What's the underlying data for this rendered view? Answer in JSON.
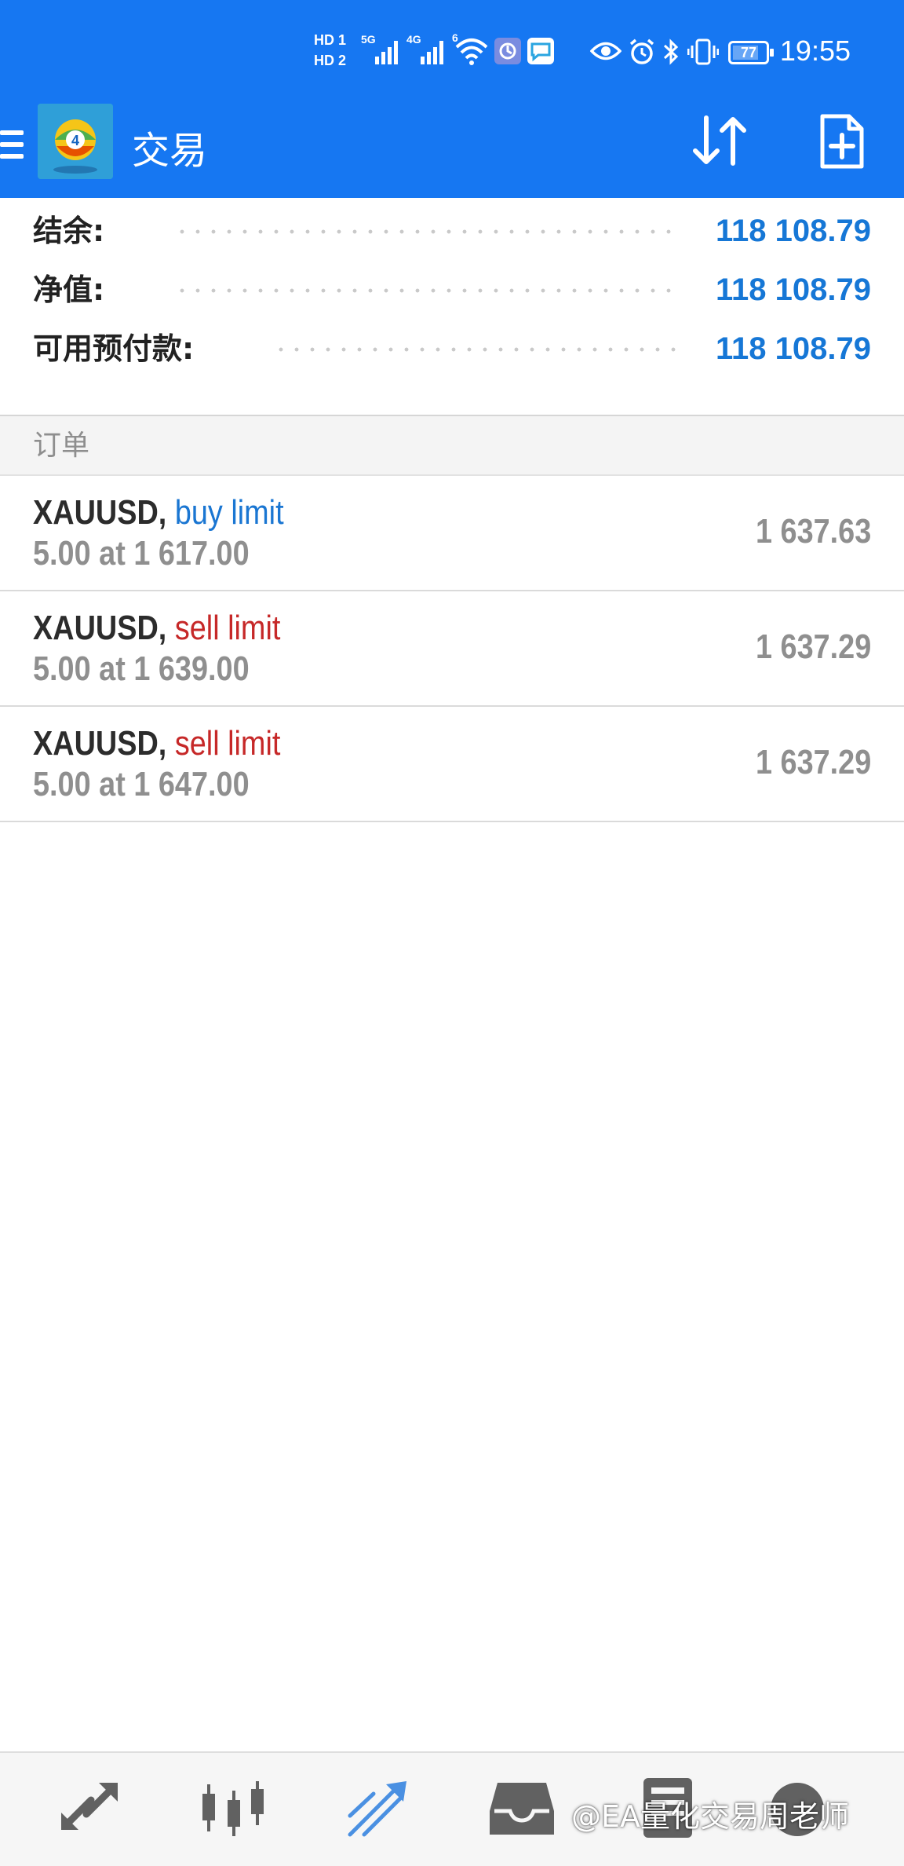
{
  "status_bar": {
    "sim_labels": [
      "HD 1",
      "HD 2"
    ],
    "network_1": "5G",
    "network_2": "4G",
    "wifi_label": "6",
    "battery_level": "77",
    "time": "19:55"
  },
  "toolbar": {
    "title": "交易"
  },
  "account": {
    "balance_label": "结余:",
    "balance_value": "118 108.79",
    "equity_label": "净值:",
    "equity_value": "118 108.79",
    "free_margin_label": "可用预付款:",
    "free_margin_value": "118 108.79"
  },
  "orders_section": {
    "title": "订单",
    "items": [
      {
        "symbol": "XAUUSD",
        "sep": ",",
        "type": "buy limit",
        "detail": "5.00 at 1 617.00",
        "price": "1 637.63"
      },
      {
        "symbol": "XAUUSD",
        "sep": ",",
        "type": "sell limit",
        "detail": "5.00 at 1 639.00",
        "price": "1 637.29"
      },
      {
        "symbol": "XAUUSD",
        "sep": ",",
        "type": "sell limit",
        "detail": "5.00 at 1 647.00",
        "price": "1 637.29"
      }
    ]
  },
  "bottom_nav": {
    "items": [
      "quotes-icon",
      "chart-icon",
      "trade-icon",
      "history-icon",
      "news-icon",
      "messages-icon"
    ],
    "active": "trade-icon",
    "watermark": "@EA量化交易周老师"
  },
  "colors": {
    "primary": "#1677f2",
    "value_blue": "#1677d6",
    "buy": "#1a76d2",
    "sell": "#c62828",
    "muted": "#8f8f8f",
    "nav_icon": "#616161",
    "nav_active": "#4a90e2"
  }
}
